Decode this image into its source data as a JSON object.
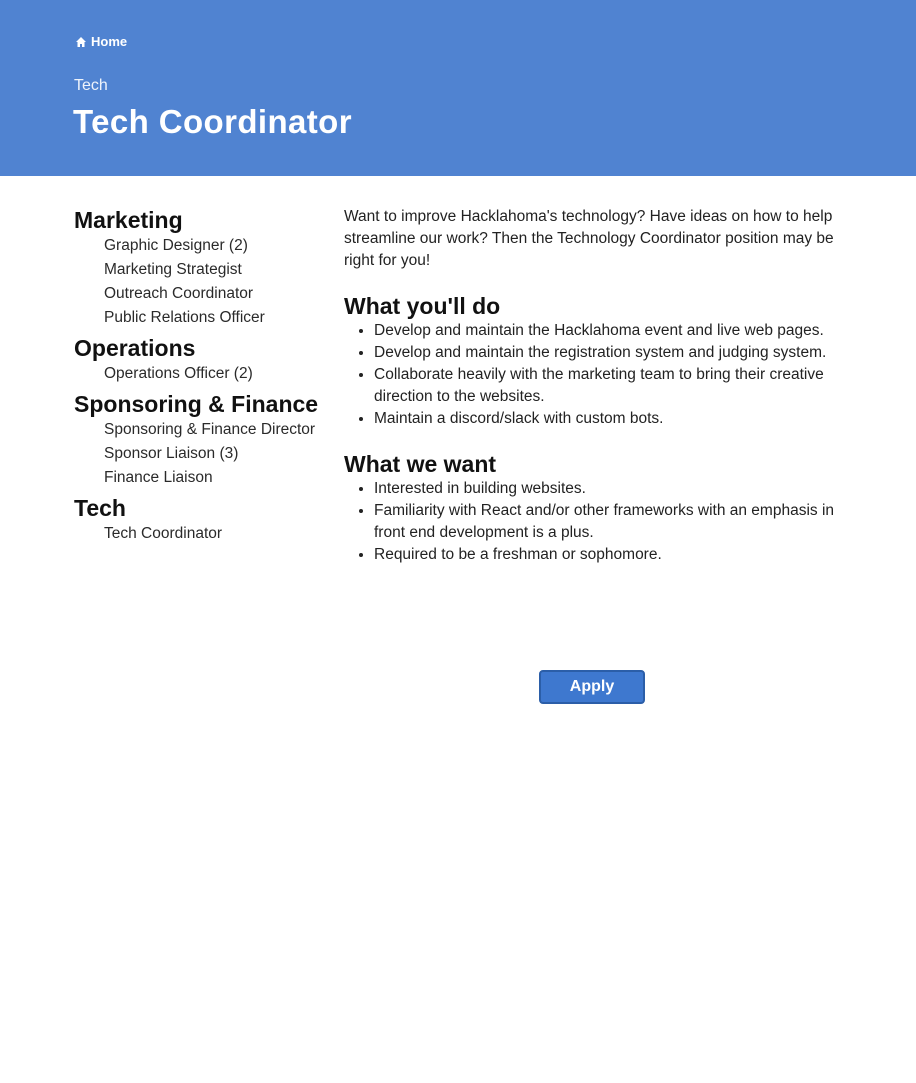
{
  "header": {
    "home_label": "Home",
    "category": "Tech",
    "title": "Tech Coordinator",
    "background_color": "#5083d1"
  },
  "sidebar": {
    "groups": [
      {
        "title": "Marketing",
        "items": [
          "Graphic Designer (2)",
          "Marketing Strategist",
          "Outreach Coordinator",
          "Public Relations Officer"
        ]
      },
      {
        "title": "Operations",
        "items": [
          "Operations Officer (2)"
        ]
      },
      {
        "title": "Sponsoring & Finance",
        "items": [
          "Sponsoring & Finance Director",
          "Sponsor Liaison (3)",
          "Finance Liaison"
        ]
      },
      {
        "title": "Tech",
        "items": [
          "Tech Coordinator"
        ]
      }
    ]
  },
  "main": {
    "intro": "Want to improve Hacklahoma's technology? Have ideas on how to help streamline our work? Then the Technology Coordinator position may be right for you!",
    "sections": [
      {
        "title": "What you'll do",
        "bullets": [
          "Develop and maintain the Hacklahoma event and live web pages.",
          "Develop and maintain the registration system and judging system.",
          "Collaborate heavily with the marketing team to bring their creative direction to the websites.",
          "Maintain a discord/slack with custom bots."
        ]
      },
      {
        "title": "What we want",
        "bullets": [
          "Interested in building websites.",
          "Familiarity with React and/or other frameworks with an emphasis in front end development is a plus.",
          "Required to be a freshman or sophomore."
        ]
      }
    ],
    "apply_label": "Apply",
    "apply_color": "#3e78cf"
  },
  "icons": {
    "home": "home-icon"
  }
}
